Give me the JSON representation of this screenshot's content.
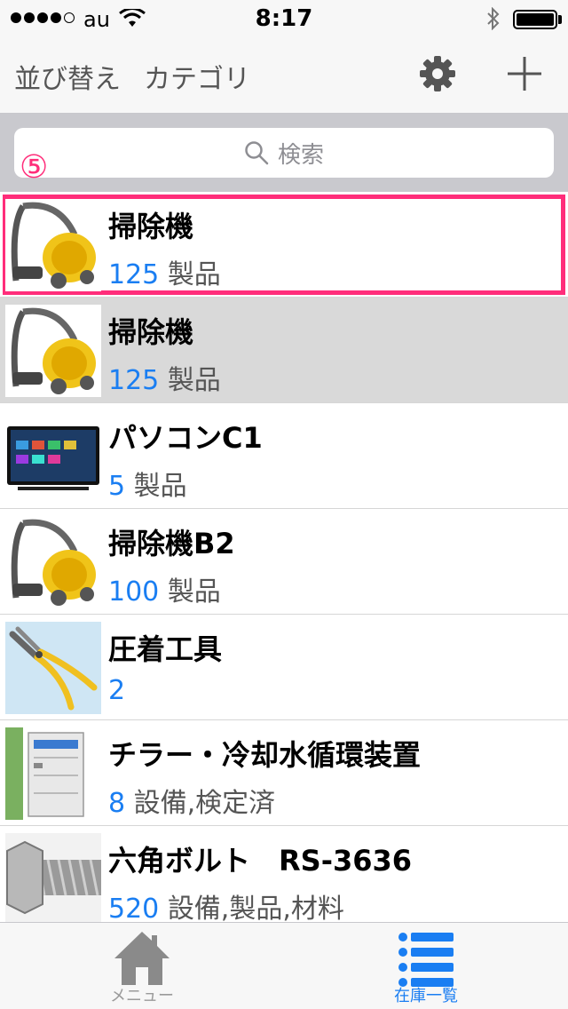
{
  "status_bar": {
    "carrier": "au",
    "time": "8:17"
  },
  "nav": {
    "sort_label": "並び替え",
    "category_label": "カテゴリ"
  },
  "search": {
    "placeholder": "検索"
  },
  "annotation_marker": "⑤",
  "items": [
    {
      "name": "掃除機",
      "count": "125",
      "tags": "製品",
      "icon": "vacuum-cleaner-thumbnail"
    },
    {
      "name": "掃除機",
      "count": "125",
      "tags": "製品",
      "icon": "vacuum-cleaner-thumbnail"
    },
    {
      "name": "パソコンC1",
      "count": "5",
      "tags": "製品",
      "icon": "monitor-thumbnail"
    },
    {
      "name": "掃除機B2",
      "count": "100",
      "tags": "製品",
      "icon": "vacuum-cleaner-thumbnail"
    },
    {
      "name": "圧着工具",
      "count": "2",
      "tags": "",
      "icon": "crimping-tool-thumbnail"
    },
    {
      "name": "チラー・冷却水循環装置",
      "count": "8",
      "tags": "設備,検定済",
      "icon": "chiller-thumbnail"
    },
    {
      "name": "六角ボルト　RS-3636",
      "count": "520",
      "tags": "設備,製品,材料",
      "icon": "hex-bolt-thumbnail"
    }
  ],
  "tabs": {
    "menu_label": "メニュー",
    "stock_label": "在庫一覧"
  },
  "colors": {
    "accent": "#1a7ef2",
    "highlight": "#ff2d7a",
    "selected_row": "#d9d9d9"
  }
}
